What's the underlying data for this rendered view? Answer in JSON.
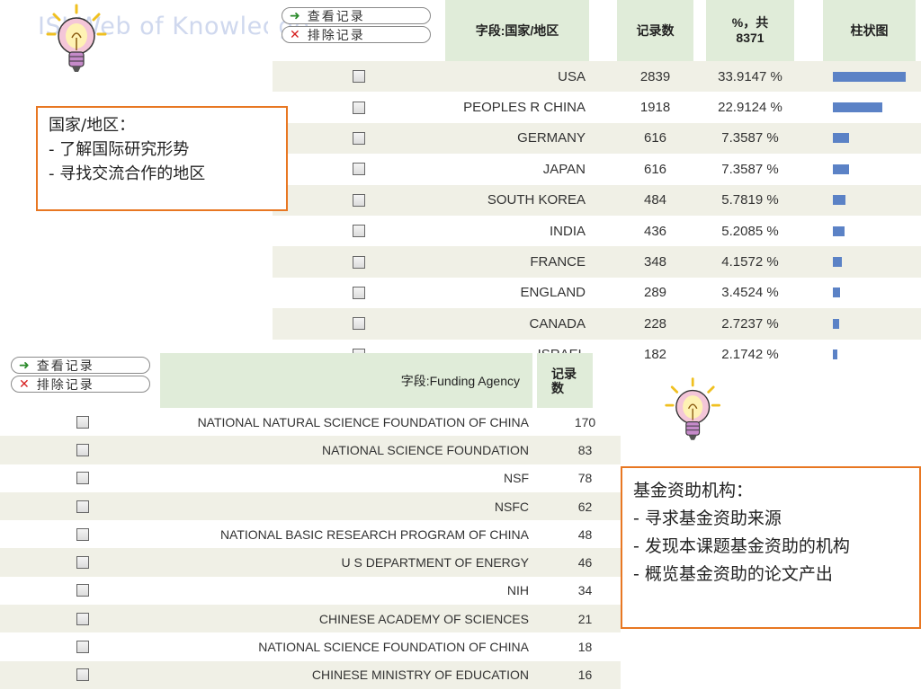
{
  "title": "ISI Web of Knowledge",
  "buttons": {
    "view": "查看记录",
    "exclude": "排除记录"
  },
  "country_table": {
    "headers": {
      "field": "字段:国家/地区",
      "count": "记录数",
      "percent": "%，共8371",
      "bar": "柱状图"
    },
    "rows": [
      {
        "name": "USA",
        "count": "2839",
        "percent": "33.9147 %",
        "share": 0.339147
      },
      {
        "name": "PEOPLES R CHINA",
        "count": "1918",
        "percent": "22.9124 %",
        "share": 0.229124
      },
      {
        "name": "GERMANY",
        "count": "616",
        "percent": "7.3587 %",
        "share": 0.073587
      },
      {
        "name": "JAPAN",
        "count": "616",
        "percent": "7.3587 %",
        "share": 0.073587
      },
      {
        "name": "SOUTH KOREA",
        "count": "484",
        "percent": "5.7819 %",
        "share": 0.057819
      },
      {
        "name": "INDIA",
        "count": "436",
        "percent": "5.2085 %",
        "share": 0.052085
      },
      {
        "name": "FRANCE",
        "count": "348",
        "percent": "4.1572 %",
        "share": 0.041572
      },
      {
        "name": "ENGLAND",
        "count": "289",
        "percent": "3.4524 %",
        "share": 0.034524
      },
      {
        "name": "CANADA",
        "count": "228",
        "percent": "2.7237 %",
        "share": 0.027237
      },
      {
        "name": "ISRAEL",
        "count": "182",
        "percent": "2.1742 %",
        "share": 0.021742
      }
    ]
  },
  "funding_table": {
    "headers": {
      "field": "字段:Funding Agency",
      "count": "记录数"
    },
    "rows": [
      {
        "name": "NATIONAL NATURAL SCIENCE FOUNDATION OF CHINA",
        "count": "170"
      },
      {
        "name": "NATIONAL SCIENCE FOUNDATION",
        "count": "83"
      },
      {
        "name": "NSF",
        "count": "78"
      },
      {
        "name": "NSFC",
        "count": "62"
      },
      {
        "name": "NATIONAL BASIC RESEARCH PROGRAM OF CHINA",
        "count": "48"
      },
      {
        "name": "U S DEPARTMENT OF ENERGY",
        "count": "46"
      },
      {
        "name": "NIH",
        "count": "34"
      },
      {
        "name": "CHINESE ACADEMY OF SCIENCES",
        "count": "21"
      },
      {
        "name": "NATIONAL SCIENCE FOUNDATION OF CHINA",
        "count": "18"
      },
      {
        "name": "CHINESE MINISTRY OF EDUCATION",
        "count": "16"
      }
    ]
  },
  "notes": {
    "country": {
      "title": "国家/地区：",
      "items": [
        "- 了解国际研究形势",
        "- 寻找交流合作的地区"
      ]
    },
    "funding": {
      "title": "基金资助机构：",
      "items": [
        "- 寻求基金资助来源",
        "- 发现本课题基金资助的机构",
        "- 概览基金资助的论文产出"
      ]
    }
  },
  "colors": {
    "accent": "#e87722",
    "bar": "#5b82c6",
    "header_bg": "#e0ecd9",
    "stripe": "#f0f0e6"
  },
  "icons": {
    "bulb": "lightbulb-icon",
    "view": "arrow-right-icon",
    "exclude": "x-icon",
    "checkbox": "checkbox-icon"
  }
}
